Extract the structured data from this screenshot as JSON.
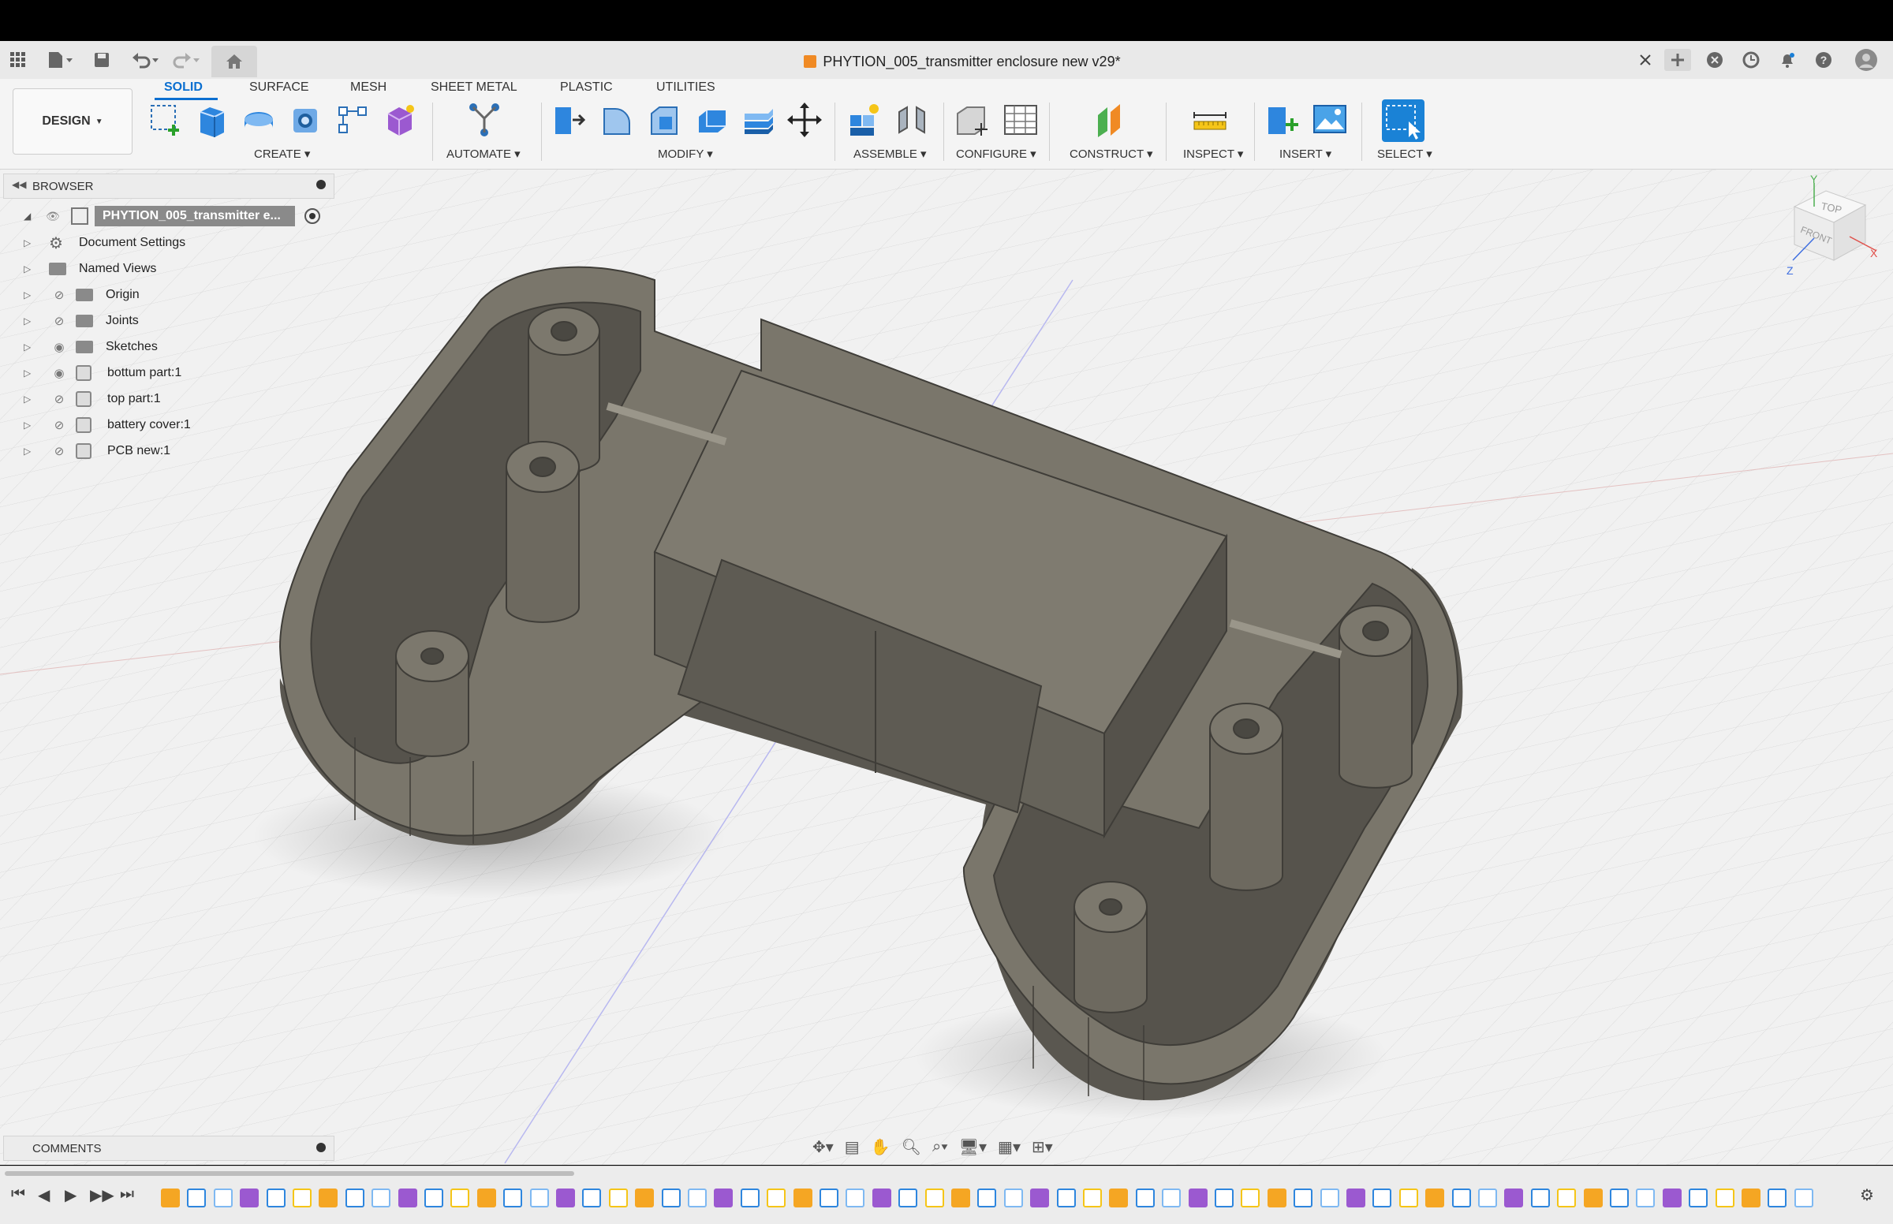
{
  "titlebar": {
    "document_title": "PHYTION_005_transmitter enclosure new v29*",
    "icons": [
      "apps-grid-icon",
      "file-icon",
      "save-icon",
      "undo-icon",
      "redo-icon",
      "home-icon",
      "close-tab-icon",
      "new-tab-icon",
      "extensions-icon",
      "job-status-icon",
      "notifications-icon",
      "help-icon",
      "avatar-icon"
    ]
  },
  "ribbon": {
    "workspace_label": "DESIGN",
    "tabs": [
      "SOLID",
      "SURFACE",
      "MESH",
      "SHEET METAL",
      "PLASTIC",
      "UTILITIES"
    ],
    "active_tab": "SOLID",
    "groups": [
      "CREATE",
      "AUTOMATE",
      "MODIFY",
      "ASSEMBLE",
      "CONFIGURE",
      "CONSTRUCT",
      "INSPECT",
      "INSERT",
      "SELECT"
    ]
  },
  "browser": {
    "title": "BROWSER",
    "root": "PHYTION_005_transmitter e...",
    "items": [
      {
        "label": "Document Settings",
        "icon": "gear-icon"
      },
      {
        "label": "Named Views",
        "icon": "folder-icon"
      },
      {
        "label": "Origin",
        "icon": "folder-icon"
      },
      {
        "label": "Joints",
        "icon": "folder-icon"
      },
      {
        "label": "Sketches",
        "icon": "folder-icon"
      },
      {
        "label": "bottum part:1",
        "icon": "body-icon"
      },
      {
        "label": "top part:1",
        "icon": "body-icon"
      },
      {
        "label": "battery cover:1",
        "icon": "body-icon"
      },
      {
        "label": "PCB new:1",
        "icon": "component-icon"
      }
    ]
  },
  "comments": {
    "title": "COMMENTS"
  },
  "viewcube": {
    "top": "TOP",
    "front": "FRONT",
    "axis_x": "X",
    "axis_y": "Y",
    "axis_z": "Z"
  },
  "colors": {
    "accent": "#0b6fd0",
    "model": "#6b675d",
    "model_light": "#7d796e",
    "model_dark": "#4e4b44"
  }
}
